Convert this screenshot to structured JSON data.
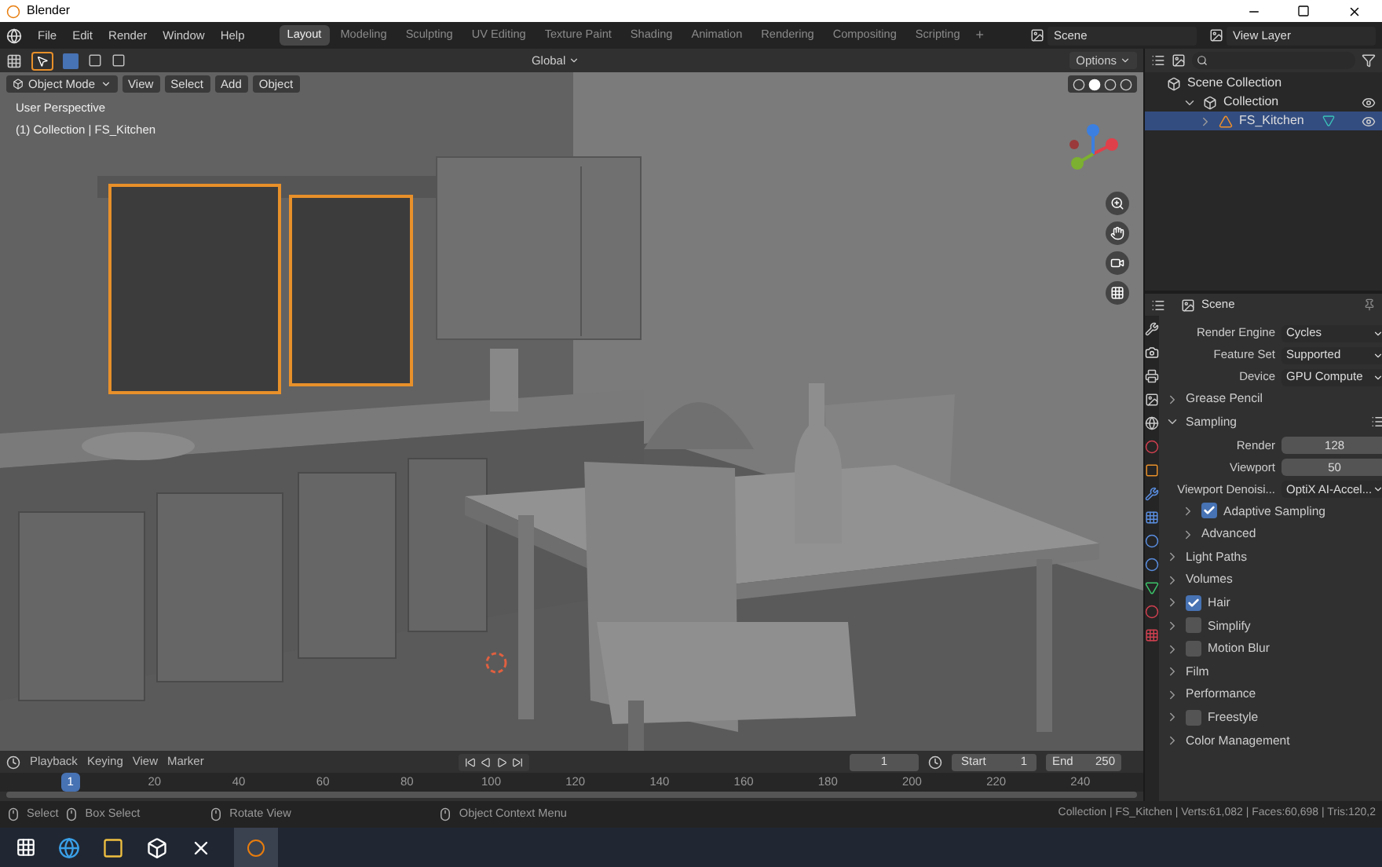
{
  "window": {
    "title": "Blender"
  },
  "menu": [
    "File",
    "Edit",
    "Render",
    "Window",
    "Help"
  ],
  "workspaces": [
    {
      "label": "Layout",
      "selected": true
    },
    {
      "label": "Modeling",
      "selected": false
    },
    {
      "label": "Sculpting",
      "selected": false
    },
    {
      "label": "UV Editing",
      "selected": false
    },
    {
      "label": "Texture Paint",
      "selected": false
    },
    {
      "label": "Shading",
      "selected": false
    },
    {
      "label": "Animation",
      "selected": false
    },
    {
      "label": "Rendering",
      "selected": false
    },
    {
      "label": "Compositing",
      "selected": false
    },
    {
      "label": "Scripting",
      "selected": false
    }
  ],
  "add_workspace": "+",
  "scene": "Scene",
  "view_layer": "View Layer",
  "tool_header": {
    "orientation": "Global",
    "options": "Options"
  },
  "viewport": {
    "mode": "Object Mode",
    "menus": [
      "View",
      "Select",
      "Add",
      "Object"
    ],
    "view_name": "User Perspective",
    "object_info": "(1) Collection | FS_Kitchen"
  },
  "outliner": {
    "items": [
      {
        "label": "Scene Collection",
        "kind": "scene",
        "selected": false,
        "children": [
          {
            "label": "Collection",
            "kind": "collection",
            "selected": false,
            "expanded": true,
            "children": [
              {
                "label": "FS_Kitchen",
                "kind": "object",
                "selected": true,
                "expanded": false
              }
            ]
          }
        ]
      }
    ]
  },
  "properties": {
    "context": "Scene",
    "rows": [
      {
        "kind": "dropdown",
        "label": "Render Engine",
        "value": "Cycles"
      },
      {
        "kind": "dropdown",
        "label": "Feature Set",
        "value": "Supported"
      },
      {
        "kind": "dropdown",
        "label": "Device",
        "value": "GPU Compute"
      },
      {
        "kind": "panel",
        "label": "Grease Pencil",
        "expanded": false
      },
      {
        "kind": "panel",
        "label": "Sampling",
        "expanded": true
      },
      {
        "kind": "number",
        "label": "Render",
        "value": "128"
      },
      {
        "kind": "number",
        "label": "Viewport",
        "value": "50"
      },
      {
        "kind": "dropdown",
        "label": "Viewport Denoisi...",
        "value": "OptiX AI-Accel..."
      },
      {
        "kind": "subpanel",
        "label": "Adaptive Sampling",
        "expanded": false,
        "checked": true
      },
      {
        "kind": "subpanel",
        "label": "Advanced",
        "expanded": false
      },
      {
        "kind": "panel",
        "label": "Light Paths",
        "expanded": false
      },
      {
        "kind": "panel",
        "label": "Volumes",
        "expanded": false
      },
      {
        "kind": "panel",
        "label": "Hair",
        "expanded": false,
        "checked": true
      },
      {
        "kind": "panel",
        "label": "Simplify",
        "expanded": false,
        "checked": false
      },
      {
        "kind": "panel",
        "label": "Motion Blur",
        "expanded": false,
        "checked": false
      },
      {
        "kind": "panel",
        "label": "Film",
        "expanded": false
      },
      {
        "kind": "panel",
        "label": "Performance",
        "expanded": false
      },
      {
        "kind": "panel",
        "label": "Freestyle",
        "expanded": false,
        "checked": false
      },
      {
        "kind": "panel",
        "label": "Color Management",
        "expanded": false
      }
    ]
  },
  "timeline": {
    "menus": [
      "Playback",
      "Keying",
      "View",
      "Marker"
    ],
    "current_frame": "1",
    "start_label": "Start",
    "start": "1",
    "end_label": "End",
    "end": "250",
    "ruler": [
      {
        "label": "1",
        "selected": true
      },
      {
        "label": "20",
        "selected": false
      },
      {
        "label": "40",
        "selected": false
      },
      {
        "label": "60",
        "selected": false
      },
      {
        "label": "80",
        "selected": false
      },
      {
        "label": "100",
        "selected": false
      },
      {
        "label": "120",
        "selected": false
      },
      {
        "label": "140",
        "selected": false
      },
      {
        "label": "160",
        "selected": false
      },
      {
        "label": "180",
        "selected": false
      },
      {
        "label": "200",
        "selected": false
      },
      {
        "label": "220",
        "selected": false
      },
      {
        "label": "240",
        "selected": false
      }
    ]
  },
  "status_bar": {
    "hints": [
      "Select",
      "Box Select",
      "Rotate View",
      "Object Context Menu"
    ],
    "stats": "Collection | FS_Kitchen | Verts:61,082 | Faces:60,698 | Tris:120,2"
  }
}
